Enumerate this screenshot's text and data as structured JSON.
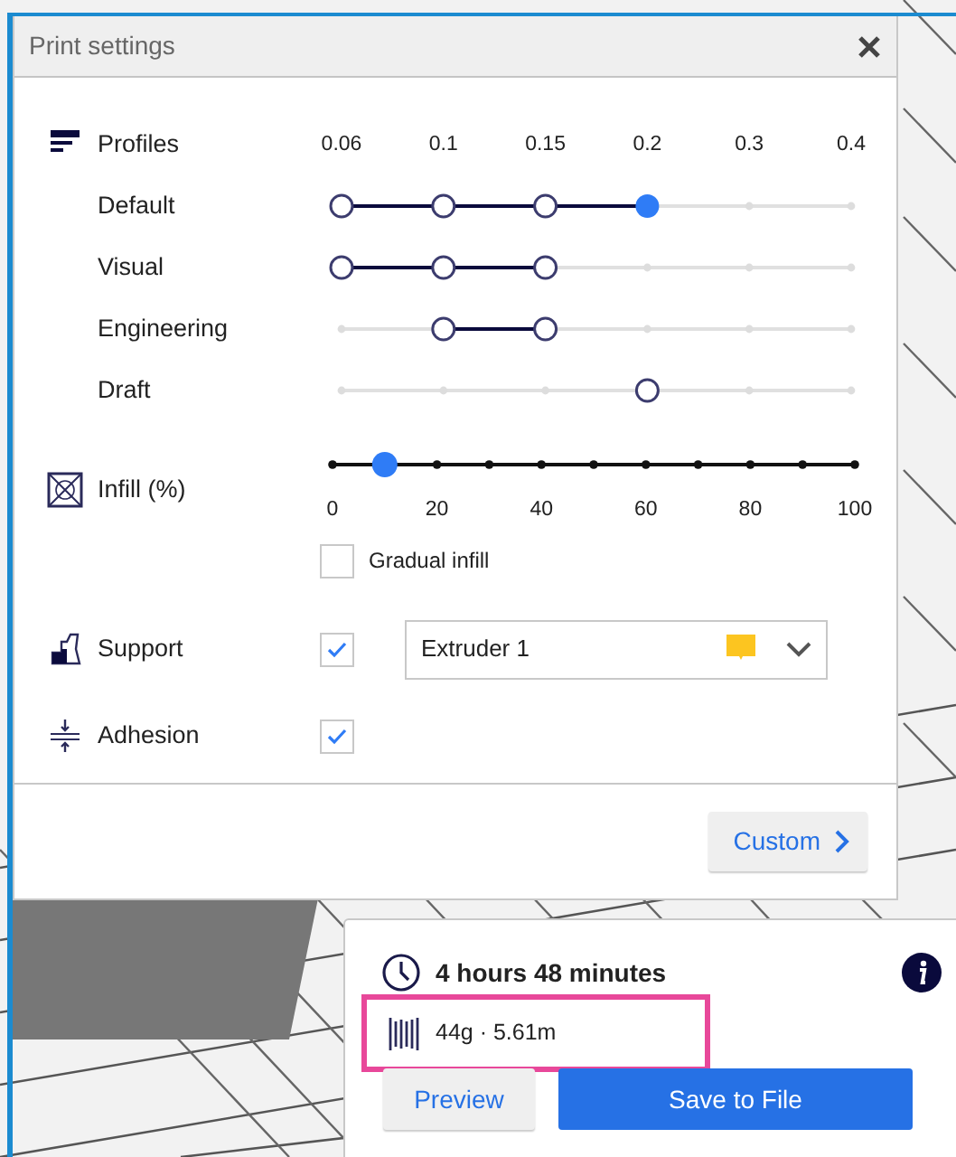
{
  "window": {
    "title": "Print settings"
  },
  "profiles": {
    "label": "Profiles",
    "layer_heights": [
      "0.06",
      "0.1",
      "0.15",
      "0.2",
      "0.3",
      "0.4"
    ],
    "rows": [
      {
        "name": "Default",
        "nodes": [
          {
            "available": true,
            "selected": false
          },
          {
            "available": true,
            "selected": false
          },
          {
            "available": true,
            "selected": false
          },
          {
            "available": true,
            "selected": true
          },
          {
            "available": false,
            "selected": false
          },
          {
            "available": false,
            "selected": false
          }
        ]
      },
      {
        "name": "Visual",
        "nodes": [
          {
            "available": true,
            "selected": false
          },
          {
            "available": true,
            "selected": false
          },
          {
            "available": true,
            "selected": false
          },
          {
            "available": false,
            "selected": false
          },
          {
            "available": false,
            "selected": false
          },
          {
            "available": false,
            "selected": false
          }
        ]
      },
      {
        "name": "Engineering",
        "nodes": [
          {
            "available": false,
            "selected": false
          },
          {
            "available": true,
            "selected": false
          },
          {
            "available": true,
            "selected": false
          },
          {
            "available": false,
            "selected": false
          },
          {
            "available": false,
            "selected": false
          },
          {
            "available": false,
            "selected": false
          }
        ]
      },
      {
        "name": "Draft",
        "nodes": [
          {
            "available": false,
            "selected": false
          },
          {
            "available": false,
            "selected": false
          },
          {
            "available": false,
            "selected": false
          },
          {
            "available": true,
            "selected": false
          },
          {
            "available": false,
            "selected": false
          },
          {
            "available": false,
            "selected": false
          }
        ]
      }
    ]
  },
  "infill": {
    "label": "Infill (%)",
    "level": 0.1,
    "tick_labels": [
      "0",
      "20",
      "40",
      "60",
      "80",
      "100"
    ]
  },
  "gradual_infill": {
    "label": "Gradual infill",
    "checked": false
  },
  "support": {
    "label": "Support",
    "checked": true,
    "extruder": {
      "value": "Extruder 1",
      "color": "#fcc520"
    }
  },
  "adhesion": {
    "label": "Adhesion",
    "checked": true
  },
  "custom_button": "Custom",
  "estimate": {
    "time": "4 hours 48 minutes",
    "material": "44g · 5.61m",
    "material_highlighted": true
  },
  "buttons": {
    "preview": "Preview",
    "save": "Save to File"
  }
}
